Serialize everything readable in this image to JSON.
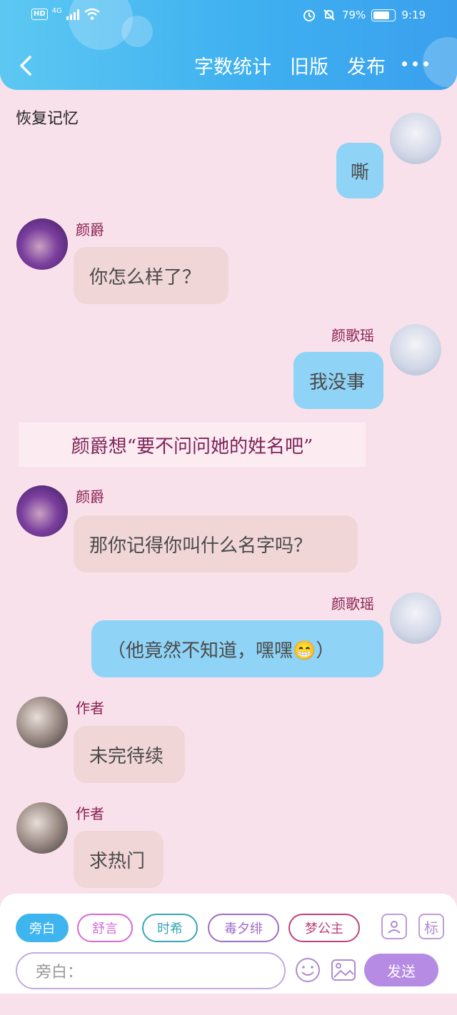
{
  "status_bar": {
    "hd": "HD",
    "network": "4G",
    "battery": "79%",
    "battery_level": 0.79,
    "time": "9:19"
  },
  "nav": {
    "back_icon": "chevron-left-icon",
    "actions": [
      "字数统计",
      "旧版",
      "发布"
    ],
    "more_icon": "more-dots-icon"
  },
  "chapter_title": "恢复记忆",
  "messages": [
    {
      "side": "right",
      "name": "",
      "text": "嘶"
    },
    {
      "side": "left",
      "name": "颜爵",
      "text": "你怎么样了？"
    },
    {
      "side": "right",
      "name": "颜歌瑶",
      "text": "我没事"
    },
    {
      "side": "narration",
      "text": "颜爵想“要不问问她的姓名吧”"
    },
    {
      "side": "left",
      "name": "颜爵",
      "text": "那你记得你叫什么名字吗？"
    },
    {
      "side": "right",
      "name": "颜歌瑶",
      "text": "（他竟然不知道，嘿嘿😁）"
    },
    {
      "side": "left",
      "name": "作者",
      "text": "未完待续"
    },
    {
      "side": "left",
      "name": "作者",
      "text": "求热门"
    }
  ],
  "composer": {
    "chips": [
      "旁白",
      "舒言",
      "时希",
      "毒夕绯",
      "梦公主"
    ],
    "chip_colors": [
      "#3fb5f0",
      "#d36ad6",
      "#36a6b6",
      "#a06ac8",
      "#c0407a"
    ],
    "tag_label": "标",
    "input_placeholder": "旁白：",
    "send_label": "发送"
  }
}
